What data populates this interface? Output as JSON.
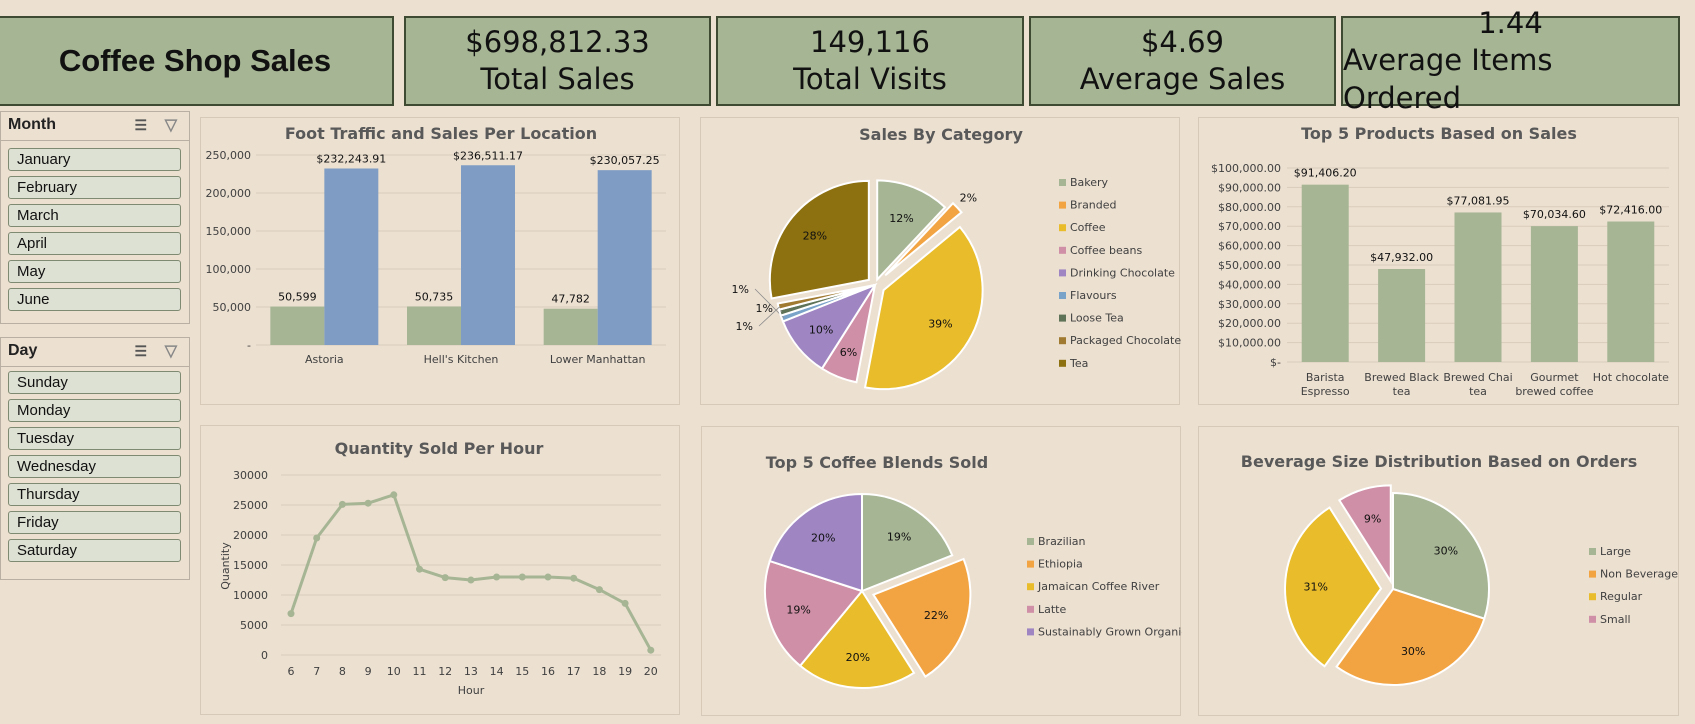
{
  "header": {
    "title": "Coffee Shop Sales"
  },
  "kpis": [
    {
      "value": "$698,812.33",
      "label": "Total Sales"
    },
    {
      "value": "149,116",
      "label": "Total Visits"
    },
    {
      "value": "$4.69",
      "label": "Average Sales"
    },
    {
      "value": "1.44",
      "label": "Average Items Ordered"
    }
  ],
  "slicers": {
    "month": {
      "title": "Month",
      "items": [
        "January",
        "February",
        "March",
        "April",
        "May",
        "June"
      ]
    },
    "day": {
      "title": "Day",
      "items": [
        "Sunday",
        "Monday",
        "Tuesday",
        "Wednesday",
        "Thursday",
        "Friday",
        "Saturday"
      ]
    }
  },
  "colors": {
    "green": "#a6b594",
    "blue": "#7f9dc4",
    "orange": "#f2a443",
    "yellow": "#e8bc2b",
    "pink": "#cf8fa6",
    "purple": "#9f86c3",
    "lightblue": "#7aa3c9",
    "darkgreen": "#5e7357",
    "brown": "#8d7010"
  },
  "chart_data": [
    {
      "id": "foot",
      "type": "bar",
      "title": "Foot Traffic and Sales Per Location",
      "categories": [
        "Astoria",
        "Hell's Kitchen",
        "Lower Manhattan"
      ],
      "series": [
        {
          "values": [
            50599,
            50735,
            47782
          ],
          "labels": [
            "50,599",
            "50,735",
            "47,782"
          ],
          "color": "#a6b594"
        },
        {
          "values": [
            232243.91,
            236511.17,
            230057.25
          ],
          "labels": [
            "$232,243.91",
            "$236,511.17",
            "$230,057.25"
          ],
          "color": "#7f9dc4"
        }
      ],
      "ylim": [
        0,
        250000
      ],
      "yticks": [
        "-",
        "50,000",
        "100,000",
        "150,000",
        "200,000",
        "250,000"
      ],
      "grid": true
    },
    {
      "id": "cat",
      "type": "pie",
      "title": "Sales By Category",
      "slices": [
        {
          "name": "Bakery",
          "value": 12,
          "label": "12%",
          "color": "#a6b594"
        },
        {
          "name": "Branded",
          "value": 2,
          "label": "2%",
          "color": "#f2a443"
        },
        {
          "name": "Coffee",
          "value": 39,
          "label": "39%",
          "color": "#e8bc2b"
        },
        {
          "name": "Coffee beans",
          "value": 6,
          "label": "6%",
          "color": "#cf8fa6"
        },
        {
          "name": "Drinking Chocolate",
          "value": 10,
          "label": "10%",
          "color": "#9f86c3"
        },
        {
          "name": "Flavours",
          "value": 1,
          "label": "1%",
          "color": "#7aa3c9"
        },
        {
          "name": "Loose Tea",
          "value": 1,
          "label": "1%",
          "color": "#5e7357"
        },
        {
          "name": "Packaged Chocolate",
          "value": 1,
          "label": "1%",
          "color": "#a07a30"
        },
        {
          "name": "Tea",
          "value": 28,
          "label": "28%",
          "color": "#8d7010"
        }
      ],
      "legend": "right"
    },
    {
      "id": "top5",
      "type": "bar",
      "title": "Top 5 Products Based on Sales",
      "categories": [
        "Barista Espresso",
        "Brewed Black tea",
        "Brewed Chai tea",
        "Gourmet brewed coffee",
        "Hot chocolate"
      ],
      "category_lines": [
        [
          "Barista",
          "Espresso"
        ],
        [
          "Brewed Black",
          "tea"
        ],
        [
          "Brewed Chai",
          "tea"
        ],
        [
          "Gourmet",
          "brewed coffee"
        ],
        [
          "Hot chocolate"
        ]
      ],
      "values": [
        91406.2,
        47932.0,
        77081.95,
        70034.6,
        72416.0
      ],
      "labels": [
        "$91,406.20",
        "$47,932.00",
        "$77,081.95",
        "$70,034.60",
        "$72,416.00"
      ],
      "ylim": [
        0,
        100000
      ],
      "yticks": [
        "$-",
        "$10,000.00",
        "$20,000.00",
        "$30,000.00",
        "$40,000.00",
        "$50,000.00",
        "$60,000.00",
        "$70,000.00",
        "$80,000.00",
        "$90,000.00",
        "$100,000.00"
      ],
      "grid": true
    },
    {
      "id": "hour",
      "type": "line",
      "title": "Quantity Sold Per Hour",
      "xlabel": "Hour",
      "ylabel": "Quantity",
      "x": [
        "6",
        "7",
        "8",
        "9",
        "10",
        "11",
        "12",
        "13",
        "14",
        "15",
        "16",
        "17",
        "18",
        "19",
        "20"
      ],
      "values": [
        6900,
        19500,
        25100,
        25300,
        26700,
        14300,
        12900,
        12500,
        13000,
        13000,
        13000,
        12800,
        10900,
        8600,
        800
      ],
      "ylim": [
        0,
        30000
      ],
      "yticks": [
        "0",
        "5000",
        "10000",
        "15000",
        "20000",
        "25000",
        "30000"
      ],
      "grid": true
    },
    {
      "id": "blend",
      "type": "pie",
      "title": "Top 5 Coffee Blends Sold",
      "slices": [
        {
          "name": "Brazilian",
          "value": 19,
          "label": "19%",
          "color": "#a6b594"
        },
        {
          "name": "Ethiopia",
          "value": 22,
          "label": "22%",
          "color": "#f2a443"
        },
        {
          "name": "Jamaican Coffee River",
          "value": 20,
          "label": "20%",
          "color": "#e8bc2b"
        },
        {
          "name": "Latte",
          "value": 19,
          "label": "19%",
          "color": "#cf8fa6"
        },
        {
          "name": "Sustainably Grown Organic",
          "value": 20,
          "label": "20%",
          "color": "#9f86c3"
        }
      ],
      "legend": "right"
    },
    {
      "id": "size",
      "type": "pie",
      "title": "Beverage Size Distribution Based on Orders",
      "slices": [
        {
          "name": "Large",
          "value": 30,
          "label": "30%",
          "color": "#a6b594"
        },
        {
          "name": "Non Beverage",
          "value": 30,
          "label": "30%",
          "color": "#f2a443"
        },
        {
          "name": "Regular",
          "value": 31,
          "label": "31%",
          "color": "#e8bc2b"
        },
        {
          "name": "Small",
          "value": 9,
          "label": "9%",
          "color": "#cf8fa6"
        }
      ],
      "legend": "right"
    }
  ]
}
